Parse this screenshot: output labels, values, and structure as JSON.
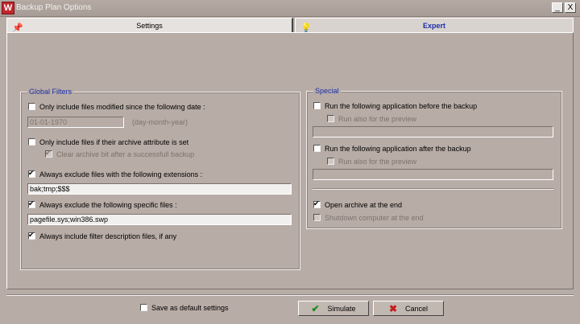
{
  "window": {
    "title": "Backup Plan Options",
    "minimize": "_",
    "close": "X"
  },
  "tabs": [
    {
      "label": "Settings",
      "icon": "pin-icon"
    },
    {
      "label": "Expert",
      "icon": "bulb-icon"
    }
  ],
  "global_filters": {
    "title": "Global Filters",
    "modified_since": {
      "label": "Only include files modified since the following date :",
      "checked": false
    },
    "date_value": "01-01-1970",
    "date_hint": "(day-month-year)",
    "archive_attribute": {
      "label": "Only include files if their archive attribute is set",
      "checked": false
    },
    "clear_archive_bit": {
      "label": "Clear archive bit after a successfull backup",
      "checked": true,
      "disabled": true
    },
    "exclude_extensions": {
      "label": "Always exclude files with the following extensions :",
      "checked": true
    },
    "extensions_value": "bak;tmp;$$$",
    "exclude_files": {
      "label": "Always exclude the following specific files :",
      "checked": true
    },
    "files_value": "pagefile.sys;win386.swp",
    "include_descriptions": {
      "label": "Always include filter description files, if any",
      "checked": true
    }
  },
  "special": {
    "title": "Special",
    "run_before": {
      "label": "Run the following application before the backup",
      "checked": false
    },
    "run_before_preview": {
      "label": "Run also for the preview",
      "checked": false,
      "disabled": true
    },
    "run_before_value": "",
    "run_after": {
      "label": "Run the following application after the backup",
      "checked": false
    },
    "run_after_preview": {
      "label": "Run also for the preview",
      "checked": false,
      "disabled": true
    },
    "run_after_value": "",
    "open_archive": {
      "label": "Open archive at the end",
      "checked": true
    },
    "shutdown": {
      "label": "Shutdown computer at the end",
      "checked": false,
      "disabled": true
    }
  },
  "footer": {
    "save_default": {
      "label": "Save as default settings",
      "checked": false
    },
    "simulate_label": "Simulate",
    "cancel_label": "Cancel"
  },
  "colors": {
    "accent": "#1a2fa8",
    "background": "#b8aca6",
    "logo": "#c1272d"
  }
}
